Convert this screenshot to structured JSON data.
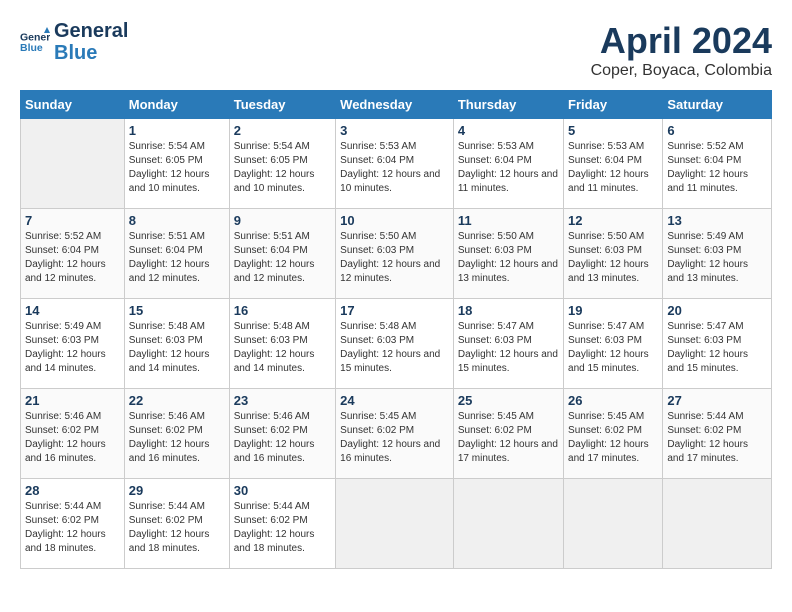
{
  "header": {
    "logo_line1": "General",
    "logo_line2": "Blue",
    "month_title": "April 2024",
    "location": "Coper, Boyaca, Colombia"
  },
  "days_of_week": [
    "Sunday",
    "Monday",
    "Tuesday",
    "Wednesday",
    "Thursday",
    "Friday",
    "Saturday"
  ],
  "weeks": [
    [
      {
        "day": "",
        "empty": true
      },
      {
        "day": "1",
        "sunrise": "5:54 AM",
        "sunset": "6:05 PM",
        "daylight": "12 hours and 10 minutes."
      },
      {
        "day": "2",
        "sunrise": "5:54 AM",
        "sunset": "6:05 PM",
        "daylight": "12 hours and 10 minutes."
      },
      {
        "day": "3",
        "sunrise": "5:53 AM",
        "sunset": "6:04 PM",
        "daylight": "12 hours and 10 minutes."
      },
      {
        "day": "4",
        "sunrise": "5:53 AM",
        "sunset": "6:04 PM",
        "daylight": "12 hours and 11 minutes."
      },
      {
        "day": "5",
        "sunrise": "5:53 AM",
        "sunset": "6:04 PM",
        "daylight": "12 hours and 11 minutes."
      },
      {
        "day": "6",
        "sunrise": "5:52 AM",
        "sunset": "6:04 PM",
        "daylight": "12 hours and 11 minutes."
      }
    ],
    [
      {
        "day": "7",
        "sunrise": "5:52 AM",
        "sunset": "6:04 PM",
        "daylight": "12 hours and 12 minutes."
      },
      {
        "day": "8",
        "sunrise": "5:51 AM",
        "sunset": "6:04 PM",
        "daylight": "12 hours and 12 minutes."
      },
      {
        "day": "9",
        "sunrise": "5:51 AM",
        "sunset": "6:04 PM",
        "daylight": "12 hours and 12 minutes."
      },
      {
        "day": "10",
        "sunrise": "5:50 AM",
        "sunset": "6:03 PM",
        "daylight": "12 hours and 12 minutes."
      },
      {
        "day": "11",
        "sunrise": "5:50 AM",
        "sunset": "6:03 PM",
        "daylight": "12 hours and 13 minutes."
      },
      {
        "day": "12",
        "sunrise": "5:50 AM",
        "sunset": "6:03 PM",
        "daylight": "12 hours and 13 minutes."
      },
      {
        "day": "13",
        "sunrise": "5:49 AM",
        "sunset": "6:03 PM",
        "daylight": "12 hours and 13 minutes."
      }
    ],
    [
      {
        "day": "14",
        "sunrise": "5:49 AM",
        "sunset": "6:03 PM",
        "daylight": "12 hours and 14 minutes."
      },
      {
        "day": "15",
        "sunrise": "5:48 AM",
        "sunset": "6:03 PM",
        "daylight": "12 hours and 14 minutes."
      },
      {
        "day": "16",
        "sunrise": "5:48 AM",
        "sunset": "6:03 PM",
        "daylight": "12 hours and 14 minutes."
      },
      {
        "day": "17",
        "sunrise": "5:48 AM",
        "sunset": "6:03 PM",
        "daylight": "12 hours and 15 minutes."
      },
      {
        "day": "18",
        "sunrise": "5:47 AM",
        "sunset": "6:03 PM",
        "daylight": "12 hours and 15 minutes."
      },
      {
        "day": "19",
        "sunrise": "5:47 AM",
        "sunset": "6:03 PM",
        "daylight": "12 hours and 15 minutes."
      },
      {
        "day": "20",
        "sunrise": "5:47 AM",
        "sunset": "6:03 PM",
        "daylight": "12 hours and 15 minutes."
      }
    ],
    [
      {
        "day": "21",
        "sunrise": "5:46 AM",
        "sunset": "6:02 PM",
        "daylight": "12 hours and 16 minutes."
      },
      {
        "day": "22",
        "sunrise": "5:46 AM",
        "sunset": "6:02 PM",
        "daylight": "12 hours and 16 minutes."
      },
      {
        "day": "23",
        "sunrise": "5:46 AM",
        "sunset": "6:02 PM",
        "daylight": "12 hours and 16 minutes."
      },
      {
        "day": "24",
        "sunrise": "5:45 AM",
        "sunset": "6:02 PM",
        "daylight": "12 hours and 16 minutes."
      },
      {
        "day": "25",
        "sunrise": "5:45 AM",
        "sunset": "6:02 PM",
        "daylight": "12 hours and 17 minutes."
      },
      {
        "day": "26",
        "sunrise": "5:45 AM",
        "sunset": "6:02 PM",
        "daylight": "12 hours and 17 minutes."
      },
      {
        "day": "27",
        "sunrise": "5:44 AM",
        "sunset": "6:02 PM",
        "daylight": "12 hours and 17 minutes."
      }
    ],
    [
      {
        "day": "28",
        "sunrise": "5:44 AM",
        "sunset": "6:02 PM",
        "daylight": "12 hours and 18 minutes."
      },
      {
        "day": "29",
        "sunrise": "5:44 AM",
        "sunset": "6:02 PM",
        "daylight": "12 hours and 18 minutes."
      },
      {
        "day": "30",
        "sunrise": "5:44 AM",
        "sunset": "6:02 PM",
        "daylight": "12 hours and 18 minutes."
      },
      {
        "day": "",
        "empty": true
      },
      {
        "day": "",
        "empty": true
      },
      {
        "day": "",
        "empty": true
      },
      {
        "day": "",
        "empty": true
      }
    ]
  ],
  "labels": {
    "sunrise": "Sunrise:",
    "sunset": "Sunset:",
    "daylight": "Daylight:"
  }
}
